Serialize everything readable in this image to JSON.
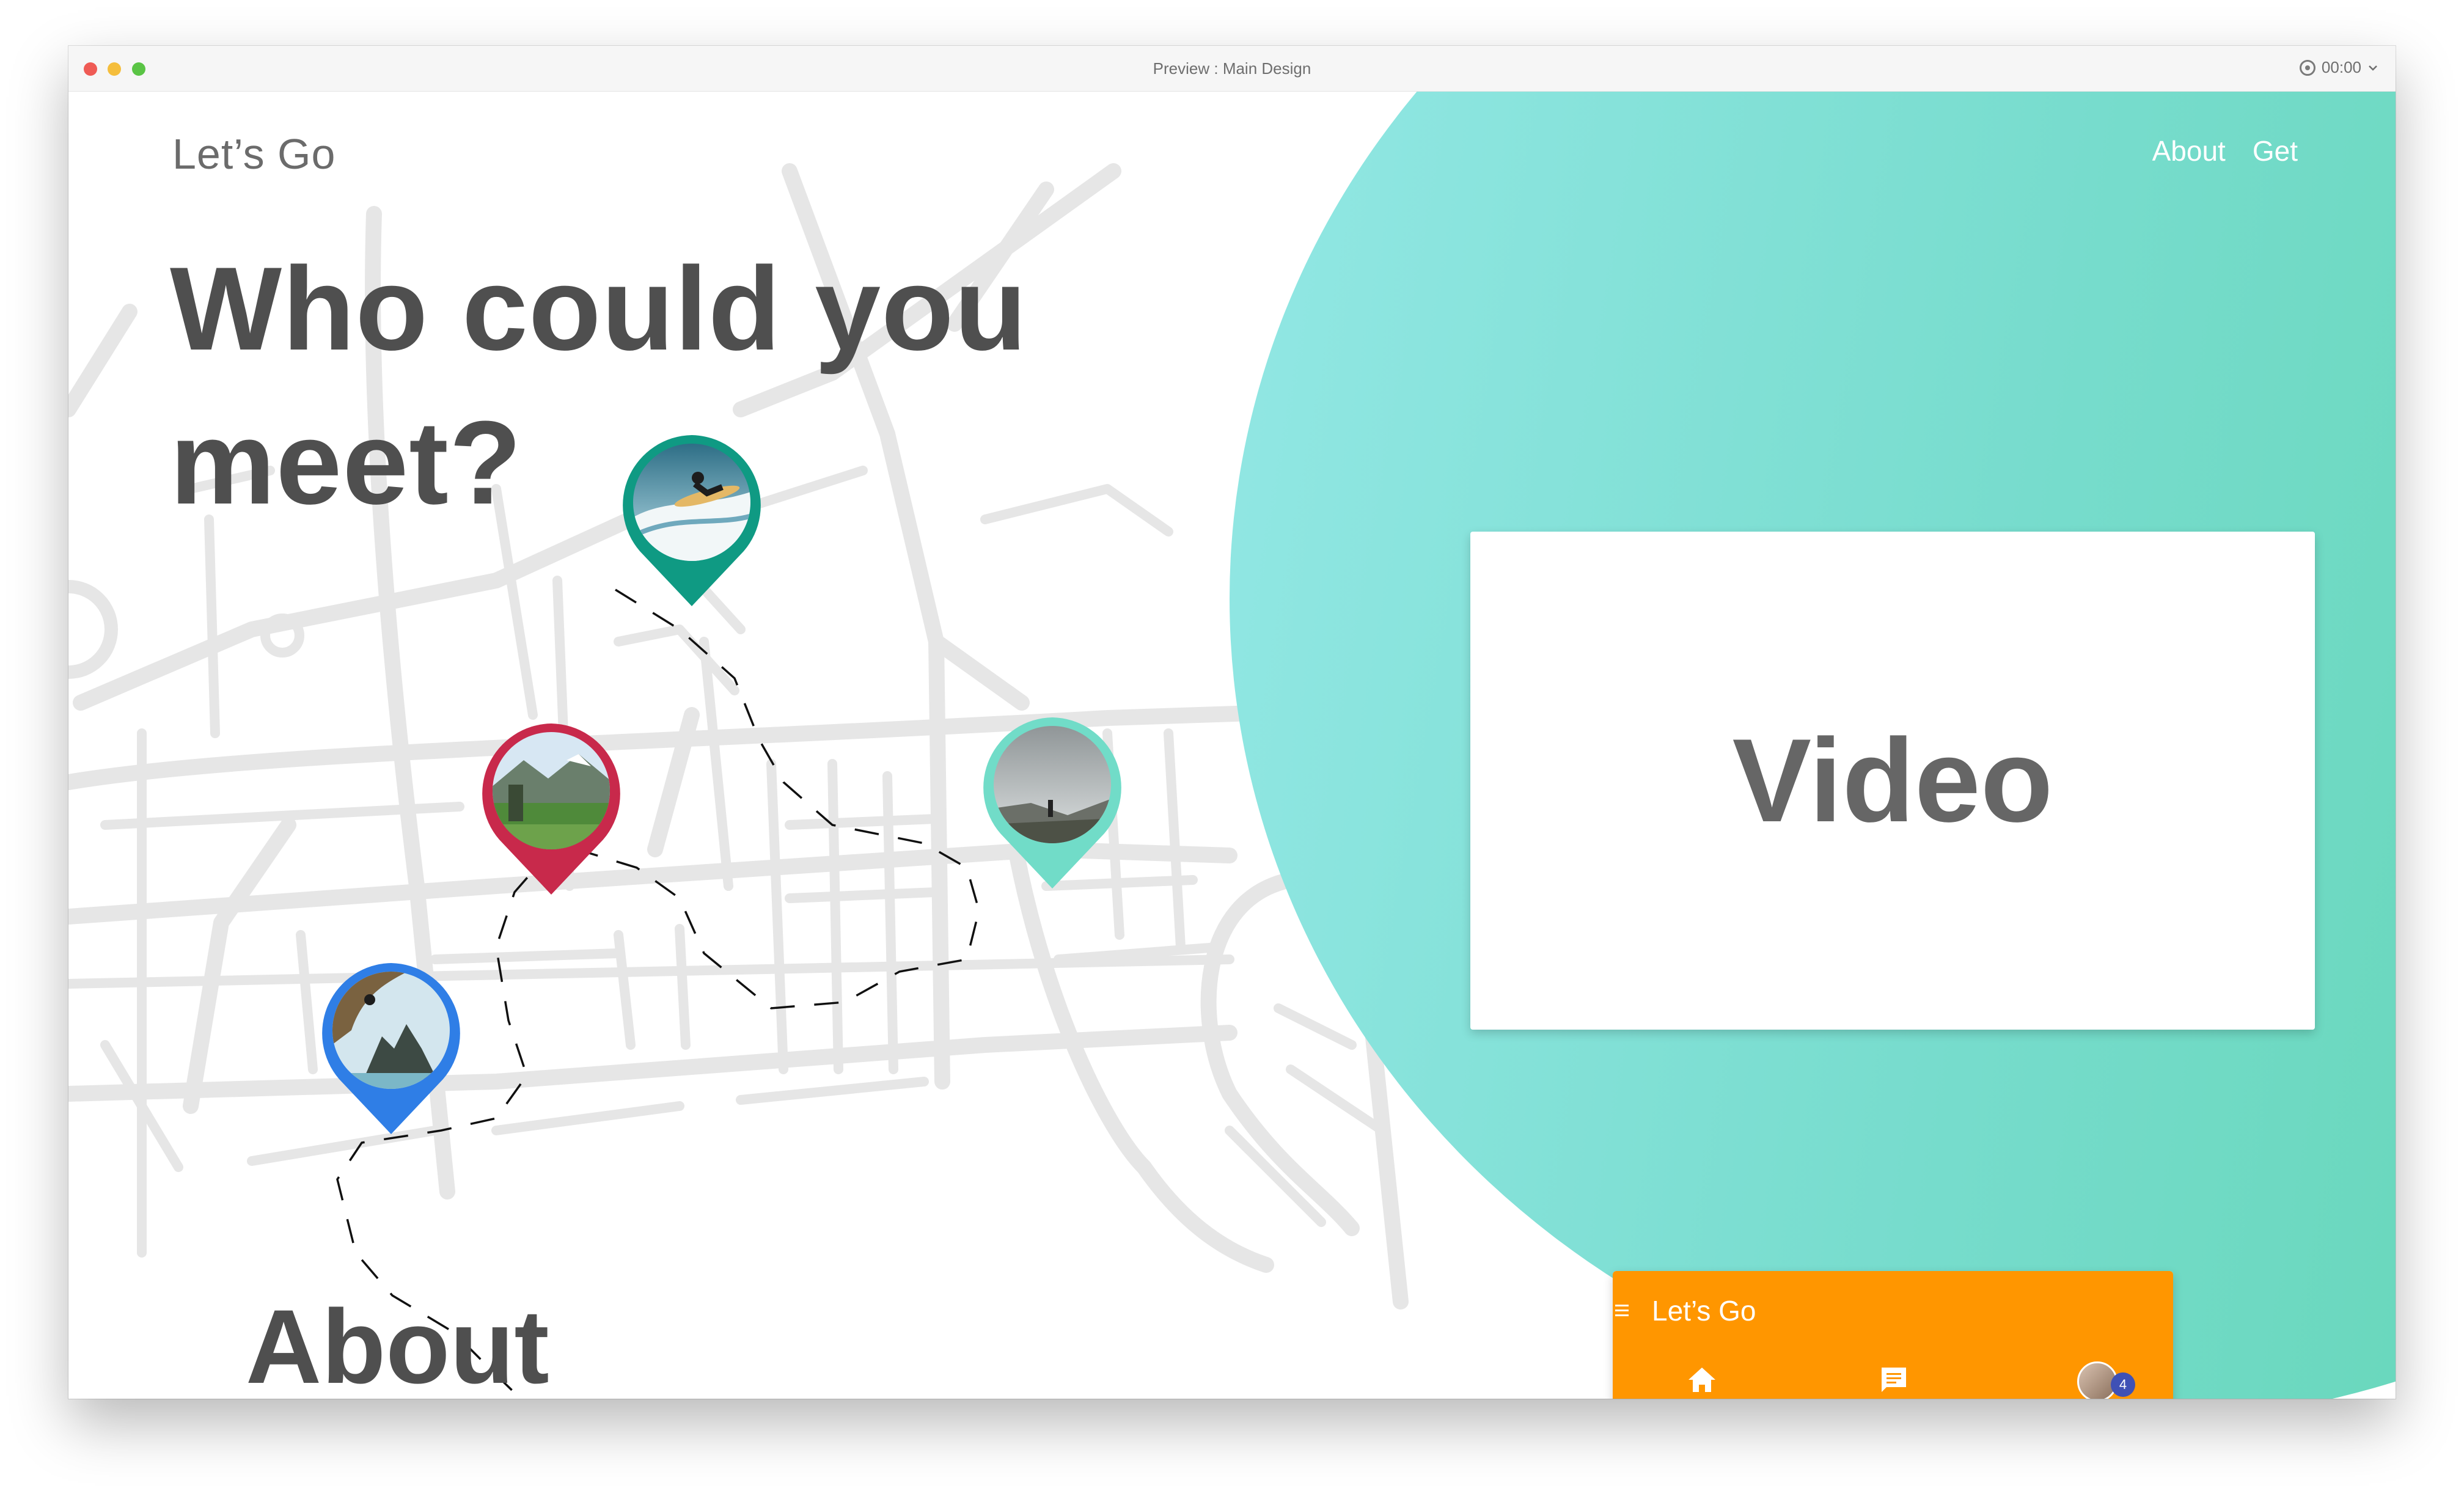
{
  "window": {
    "title": "Preview : Main Design",
    "timer": "00:00"
  },
  "site": {
    "brand": "Let’s Go",
    "nav": [
      "About",
      "Get"
    ],
    "hero_title": "Who could you meet?",
    "about_heading": "About",
    "video_label": "Video"
  },
  "phone": {
    "title": "Let’s Go",
    "badge_count": "4"
  },
  "pins": [
    {
      "name": "surfer-pin",
      "color": "#0f9a83",
      "photo": "surfer"
    },
    {
      "name": "meadow-pin",
      "color": "#c8294b",
      "photo": "meadow"
    },
    {
      "name": "hiker-pin",
      "color": "#71dcc8",
      "photo": "hiker"
    },
    {
      "name": "climber-pin",
      "color": "#2f7ee6",
      "photo": "climber"
    }
  ],
  "colors": {
    "gradient_start": "#94e8e6",
    "gradient_end": "#5bd3ab",
    "phone_bar": "#ff9600",
    "accent_indigo": "#3f51b5",
    "heading_text": "#4f4f4f"
  }
}
